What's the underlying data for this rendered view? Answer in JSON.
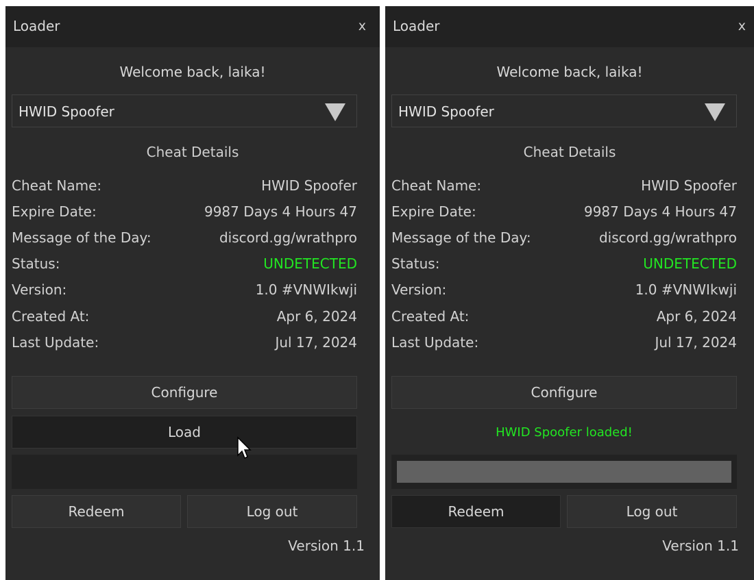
{
  "colors": {
    "background": "#2b2b2b",
    "titlebar": "#222222",
    "undetected": "#22e622"
  },
  "windows": [
    {
      "title": "Loader",
      "close_label": "x",
      "welcome": "Welcome back, laika!",
      "dropdown": {
        "value": "HWID Spoofer",
        "icon": "triangle-down-icon"
      },
      "section_title": "Cheat Details",
      "details": [
        {
          "label": "Cheat Name:",
          "value": "HWID Spoofer"
        },
        {
          "label": "Expire Date:",
          "value": "9987 Days 4 Hours 47"
        },
        {
          "label": "Message of the Day:",
          "value": "discord.gg/wrathpro"
        },
        {
          "label": "Status:",
          "value": "UNDETECTED"
        },
        {
          "label": "Version:",
          "value": "1.0 #VNWIkwji"
        },
        {
          "label": "Created At:",
          "value": "Apr 6, 2024"
        },
        {
          "label": "Last Update:",
          "value": "Jul 17, 2024"
        }
      ],
      "configure_label": "Configure",
      "load_label": "Load",
      "progress": 0,
      "redeem_label": "Redeem",
      "logout_label": "Log out",
      "version": "Version 1.1"
    },
    {
      "title": "Loader",
      "close_label": "x",
      "welcome": "Welcome back, laika!",
      "dropdown": {
        "value": "HWID Spoofer",
        "icon": "triangle-down-icon"
      },
      "section_title": "Cheat Details",
      "details": [
        {
          "label": "Cheat Name:",
          "value": "HWID Spoofer"
        },
        {
          "label": "Expire Date:",
          "value": "9987 Days 4 Hours 47"
        },
        {
          "label": "Message of the Day:",
          "value": "discord.gg/wrathpro"
        },
        {
          "label": "Status:",
          "value": "UNDETECTED"
        },
        {
          "label": "Version:",
          "value": "1.0 #VNWIkwji"
        },
        {
          "label": "Created At:",
          "value": "Apr 6, 2024"
        },
        {
          "label": "Last Update:",
          "value": "Jul 17, 2024"
        }
      ],
      "configure_label": "Configure",
      "status_message": "HWID Spoofer loaded!",
      "progress": 1.0,
      "redeem_label": "Redeem",
      "logout_label": "Log out",
      "version": "Version 1.1"
    }
  ]
}
